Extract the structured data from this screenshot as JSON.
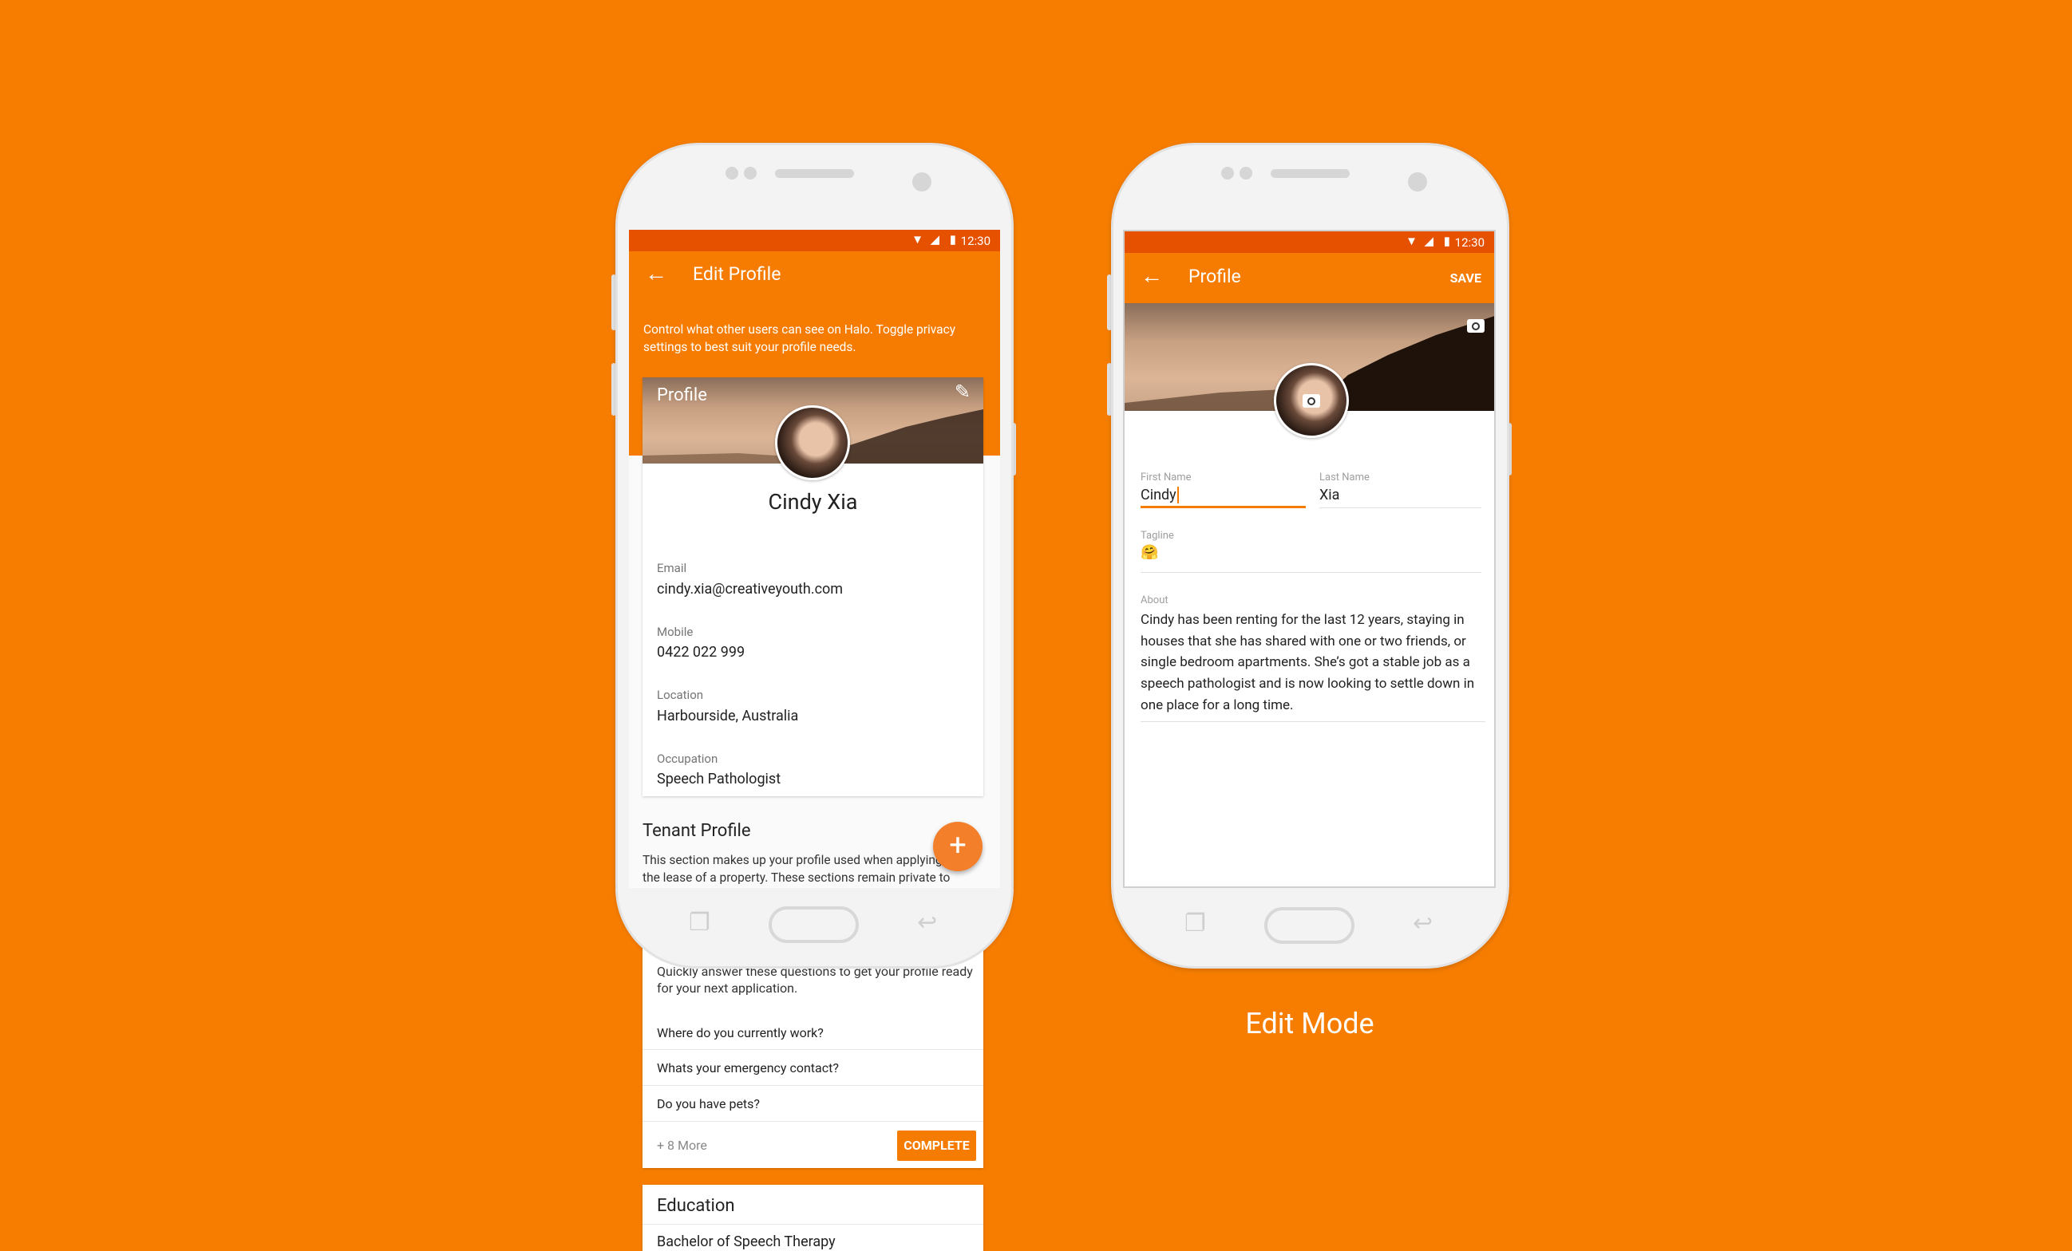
{
  "colors": {
    "background": "#F67D00",
    "status_bar": "#E65100",
    "app_bar": "#F57C00",
    "accent": "#F57C00"
  },
  "status": {
    "time": "12:30",
    "icons": [
      "wifi-icon",
      "signal-icon",
      "battery-icon"
    ]
  },
  "left": {
    "title": "Edit Profile",
    "description": "Control what other users can see on Halo. Toggle privacy settings to best suit your profile needs.",
    "profile_card": {
      "heading": "Profile",
      "name": "Cindy Xia",
      "fields": [
        {
          "label": "Email",
          "value": "cindy.xia@creativeyouth.com"
        },
        {
          "label": "Mobile",
          "value": "0422 022 999"
        },
        {
          "label": "Location",
          "value": "Harbourside, Australia"
        },
        {
          "label": "Occupation",
          "value": "Speech Pathologist"
        }
      ]
    },
    "tenant": {
      "heading": "Tenant Profile",
      "line1": "This section makes up your profile used when applying",
      "line2": "the lease of a property. These sections remain private to",
      "card_line1": "Quickly answer these questions to get your profile ready",
      "card_line2": "for your next application.",
      "questions": [
        "Where do you currently work?",
        "Whats your emergency contact?",
        "Do you have pets?"
      ],
      "more": "+ 8 More",
      "complete": "COMPLETE"
    },
    "education": {
      "heading": "Education",
      "item": "Bachelor of Speech Therapy"
    }
  },
  "right": {
    "title": "Profile",
    "save": "SAVE",
    "first_name": {
      "label": "First Name",
      "value": "Cindy"
    },
    "last_name": {
      "label": "Last Name",
      "value": "Xia"
    },
    "tagline": {
      "label": "Tagline",
      "value": "🤗"
    },
    "about": {
      "label": "About",
      "value": "Cindy has been renting for the last 12 years, staying in houses that she has shared with one or two friends, or single bedroom apartments. She’s got a stable job as a speech pathologist and is now looking to settle down in one place for a long time."
    }
  },
  "caption": "Edit Mode"
}
